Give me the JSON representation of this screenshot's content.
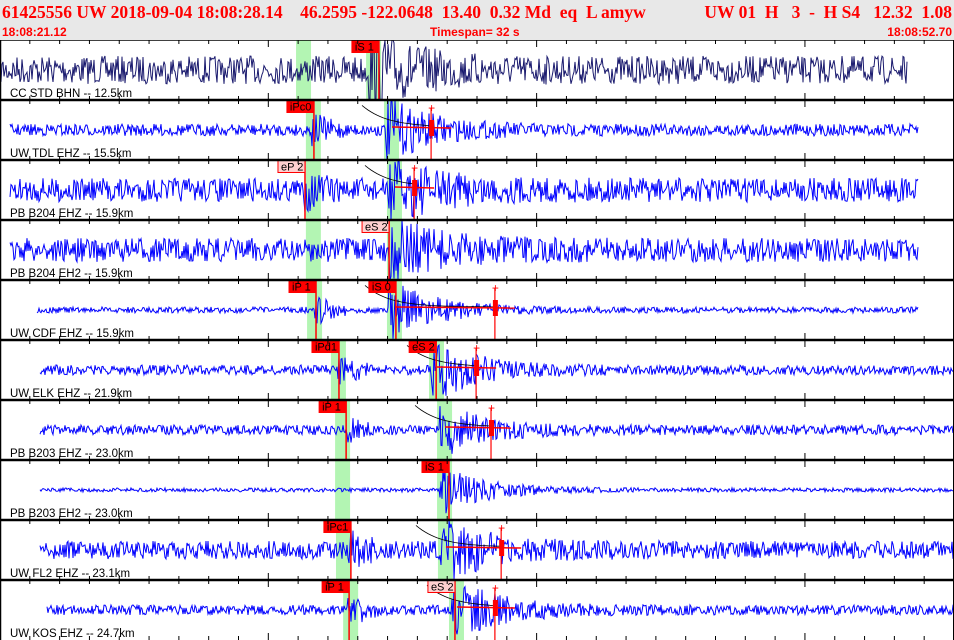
{
  "header": {
    "event_info": "61425556 UW 2018-09-04 18:08:28.14    46.2595 -122.0648  13.40  0.32 Md  eq  L amyw",
    "solution_info": "UW 01  H   3  -  H S4   12.32  1.08",
    "start_time": "18:08:21.12",
    "timespan": "Timespan=  32 s",
    "end_time": "18:08:52.70"
  },
  "timespan_seconds": 32,
  "colors": {
    "pick_firm": "#ff0000",
    "pick_emergent": "#ffd0d0",
    "window": "#b3f5b3",
    "trace": "#0000ff",
    "trace_first": "#1a1a6e",
    "header_text": "#ff0000"
  },
  "traces": [
    {
      "label": "CC STD BHN -- 12.5km",
      "windows": [
        "18:08:31.05",
        "18:08:33.40"
      ],
      "picks": [
        {
          "label": "iS 1",
          "time": "18:08:33.83",
          "firm": true
        }
      ],
      "coda_end": null
    },
    {
      "label": "UW TDL EHZ -- 15.5km",
      "windows": [
        "18:08:31.38",
        "18:08:34.00"
      ],
      "picks": [
        {
          "label": "iPc0",
          "time": "18:08:31.65",
          "firm": true
        }
      ],
      "coda_end": "18:08:35.58"
    },
    {
      "label": "PB B204 EHZ -- 15.9km",
      "windows": [
        "18:08:31.38",
        "18:08:34.10"
      ],
      "picks": [
        {
          "label": "eP 2",
          "time": "18:08:31.35",
          "firm": false
        }
      ],
      "coda_end": "18:08:35.01"
    },
    {
      "label": "PB B204 EH2 -- 15.9km",
      "windows": [
        "18:08:31.38",
        "18:08:34.10"
      ],
      "picks": [
        {
          "label": "eS 2",
          "time": "18:08:34.17",
          "firm": false
        }
      ],
      "coda_end": null
    },
    {
      "label": "UW CDF EHZ -- 15.9km",
      "windows": [
        "18:08:31.42",
        "18:08:34.10"
      ],
      "picks": [
        {
          "label": "iP 1",
          "time": "18:08:31.72",
          "firm": true
        },
        {
          "label": "iS 0",
          "time": "18:08:34.40",
          "firm": true
        }
      ],
      "coda_end": "18:08:37.72"
    },
    {
      "label": "UW ELK EHZ -- 21.9km",
      "windows": [
        "18:08:32.22",
        "18:08:35.51"
      ],
      "picks": [
        {
          "label": "iPd1",
          "time": "18:08:32.49",
          "firm": true
        },
        {
          "label": "eS 2",
          "time": "18:08:35.75",
          "firm": true
        }
      ],
      "coda_end": "18:08:37.09"
    },
    {
      "label": "PB B203 EHZ -- 23.0km",
      "windows": [
        "18:08:32.36",
        "18:08:35.78"
      ],
      "picks": [
        {
          "label": "iP 1",
          "time": "18:08:32.73",
          "firm": true
        }
      ],
      "coda_end": "18:08:37.59"
    },
    {
      "label": "PB B203 EH2 -- 23.0km",
      "windows": [
        "18:08:32.36",
        "18:08:35.78"
      ],
      "picks": [
        {
          "label": "iS 1",
          "time": "18:08:36.18",
          "firm": true
        }
      ],
      "coda_end": null
    },
    {
      "label": "UW FL2 EHZ -- 23.1km",
      "windows": [
        "18:08:32.39",
        "18:08:35.81"
      ],
      "picks": [
        {
          "label": "iPc1",
          "time": "18:08:32.89",
          "firm": true
        }
      ],
      "coda_end": "18:08:37.93"
    },
    {
      "label": "UW KOS EHZ -- 24.7km",
      "windows": [
        "18:08:32.63",
        "18:08:36.18"
      ],
      "picks": [
        {
          "label": "iP 1",
          "time": "18:08:32.83",
          "firm": true
        },
        {
          "label": "eS 2",
          "time": "18:08:36.38",
          "firm": false
        }
      ],
      "coda_end": "18:08:37.72"
    }
  ]
}
